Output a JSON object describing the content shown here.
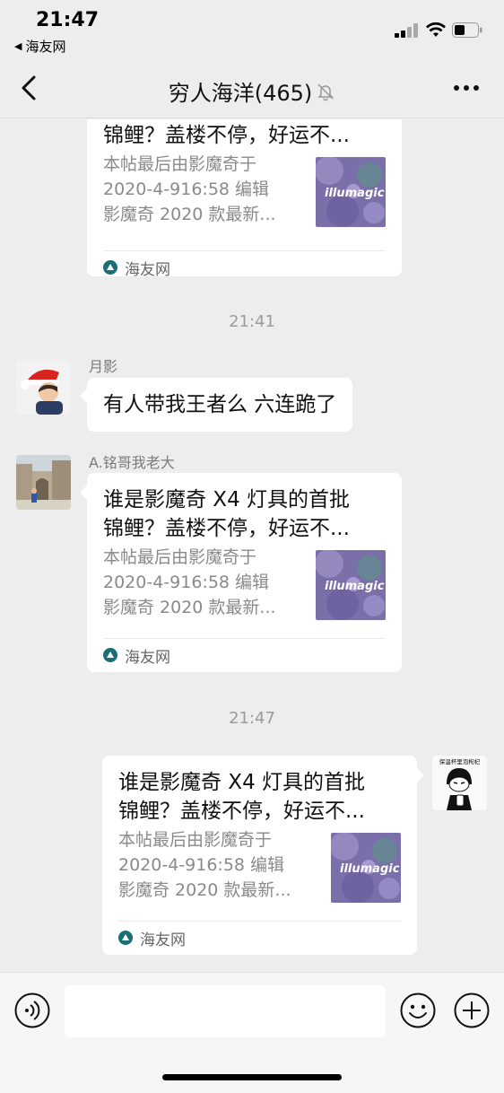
{
  "status_bar": {
    "time": "21:47",
    "back_app": "海友网"
  },
  "nav": {
    "title": "穷人海洋(465)"
  },
  "messages": {
    "card1": {
      "title": "锦鲤？盖楼不停，好运不...",
      "desc_lines": [
        "本帖最后由影魔奇于",
        "2020-4-916:58 编辑",
        "影魔奇 2020 款最新..."
      ],
      "source": "海友网"
    },
    "time1": "21:41",
    "msg2": {
      "sender": "月影",
      "text": "有人带我王者么 六连跪了"
    },
    "msg3": {
      "sender": "A.铭哥我老大",
      "title_lines": [
        "谁是影魔奇 X4 灯具的首批",
        "锦鲤？盖楼不停，好运不..."
      ],
      "desc_lines": [
        "本帖最后由影魔奇于",
        "2020-4-916:58 编辑",
        "影魔奇 2020 款最新..."
      ],
      "source": "海友网"
    },
    "time2": "21:47",
    "msg4": {
      "title_lines": [
        "谁是影魔奇 X4 灯具的首批",
        "锦鲤？盖楼不停，好运不..."
      ],
      "desc_lines": [
        "本帖最后由影魔奇于",
        "2020-4-916:58 编辑",
        "影魔奇 2020 款最新..."
      ],
      "source": "海友网",
      "avatar_caption": "保温杯里泡枸杞"
    }
  },
  "thumb_text": "illumagic",
  "input": {
    "value": ""
  },
  "colors": {
    "background": "#ededed",
    "bubble": "#ffffff",
    "timestamp": "#9b9b9b",
    "source_icon": "#1a6f73"
  }
}
